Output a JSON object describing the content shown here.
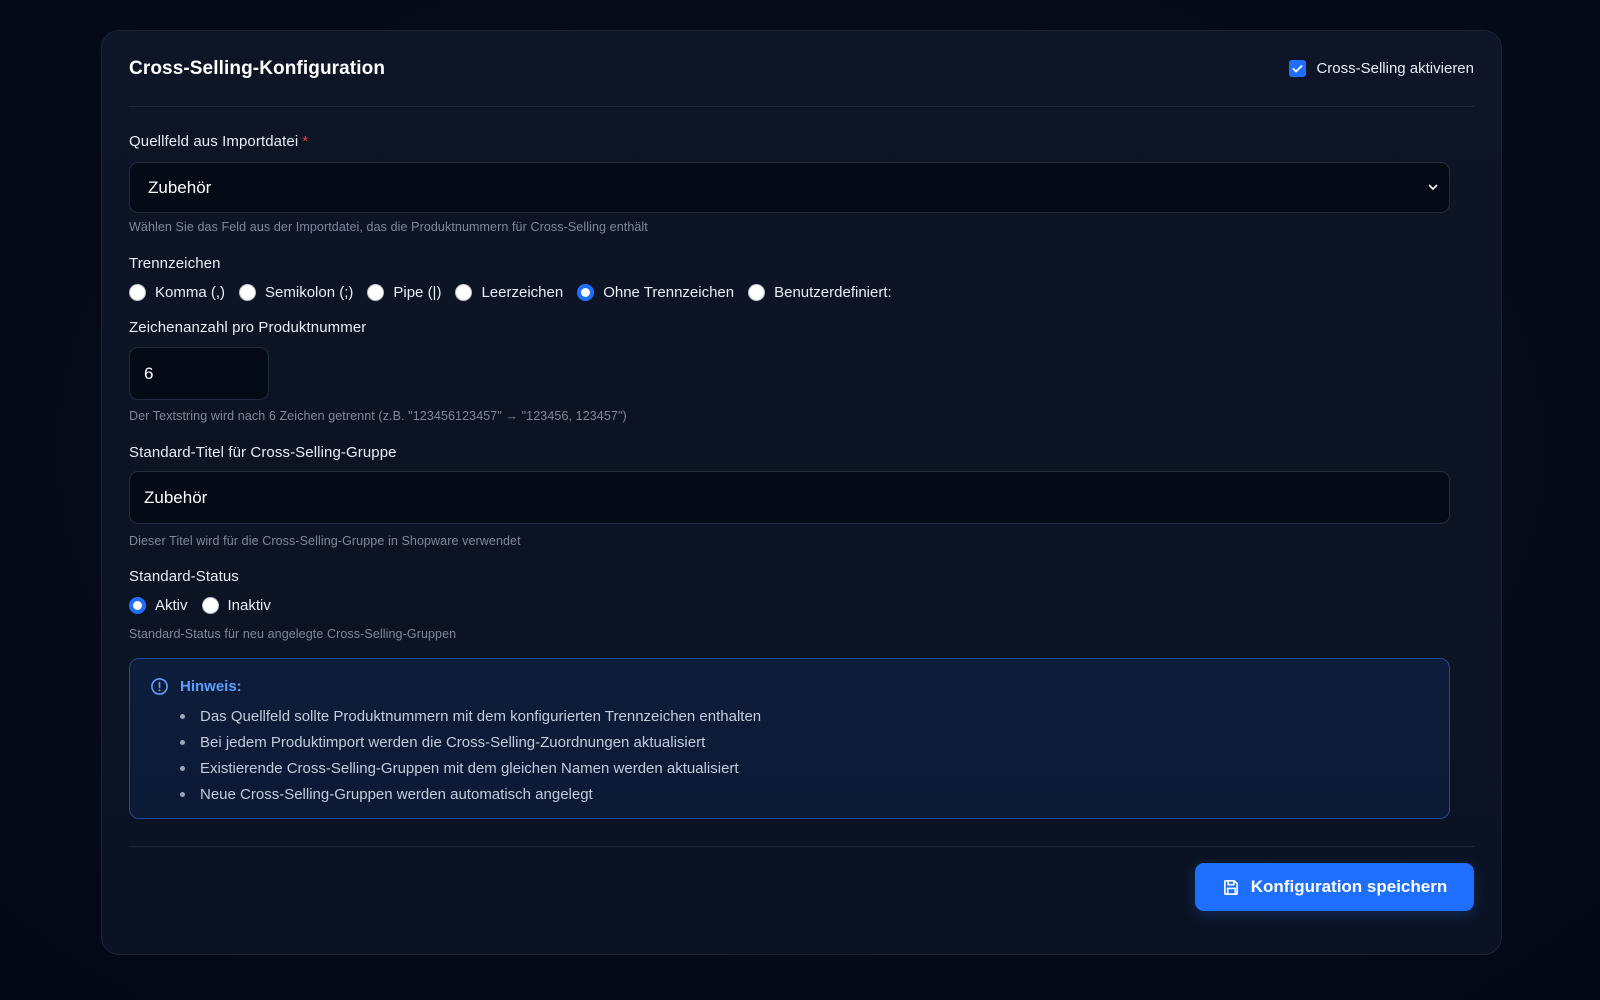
{
  "header": {
    "title": "Cross-Selling-Konfiguration",
    "enable_label": "Cross-Selling aktivieren",
    "enable_checked": true
  },
  "source_field": {
    "label": "Quellfeld aus Importdatei",
    "required_mark": "*",
    "selected": "Zubehör",
    "hint": "Wählen Sie das Feld aus der Importdatei, das die Produktnummern für Cross-Selling enthält"
  },
  "separator": {
    "label": "Trennzeichen",
    "options": [
      {
        "label": "Komma (,)",
        "checked": false
      },
      {
        "label": "Semikolon (;)",
        "checked": false
      },
      {
        "label": "Pipe (|)",
        "checked": false
      },
      {
        "label": "Leerzeichen",
        "checked": false
      },
      {
        "label": "Ohne Trennzeichen",
        "checked": true
      },
      {
        "label": "Benutzerdefiniert:",
        "checked": false
      }
    ]
  },
  "char_count": {
    "label": "Zeichenanzahl pro Produktnummer",
    "value": "6",
    "hint": "Der Textstring wird nach 6 Zeichen getrennt (z.B. \"123456123457\" → \"123456, 123457\")"
  },
  "default_title": {
    "label": "Standard-Titel für Cross-Selling-Gruppe",
    "value": "Zubehör",
    "hint": "Dieser Titel wird für die Cross-Selling-Gruppe in Shopware verwendet"
  },
  "default_status": {
    "label": "Standard-Status",
    "options": [
      {
        "label": "Aktiv",
        "checked": true
      },
      {
        "label": "Inaktiv",
        "checked": false
      }
    ],
    "hint": "Standard-Status für neu angelegte Cross-Selling-Gruppen"
  },
  "notice": {
    "icon": "info-circle-icon",
    "title": "Hinweis:",
    "items": [
      "Das Quellfeld sollte Produktnummern mit dem konfigurierten Trennzeichen enthalten",
      "Bei jedem Produktimport werden die Cross-Selling-Zuordnungen aktualisiert",
      "Existierende Cross-Selling-Gruppen mit dem gleichen Namen werden aktualisiert",
      "Neue Cross-Selling-Gruppen werden automatisch angelegt"
    ]
  },
  "save_button": {
    "icon": "save-icon",
    "label": "Konfiguration speichern"
  },
  "colors": {
    "accent": "#1f6fff",
    "background": "#050a18",
    "card": "#0d1526",
    "notice_border": "#1f4c93",
    "notice_title": "#5aa0ff",
    "required": "#ef4444"
  }
}
